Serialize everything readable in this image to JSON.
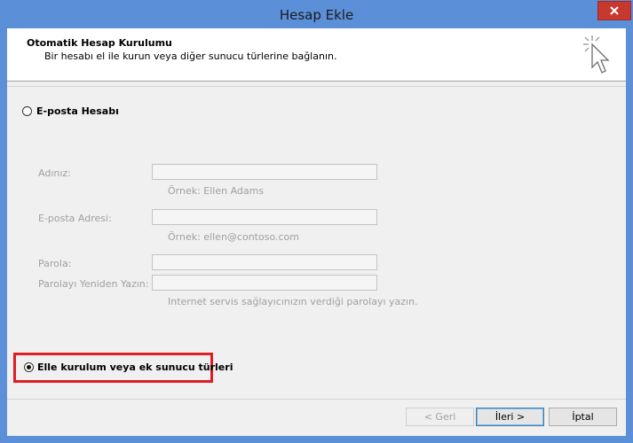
{
  "window": {
    "title": "Hesap Ekle",
    "close_glyph": "✕"
  },
  "header": {
    "title": "Otomatik Hesap Kurulumu",
    "subtitle": "Bir hesabı el ile kurun veya diğer sunucu türlerine bağlanın.",
    "icon": "wizard-cursor-sparkle-icon"
  },
  "options": {
    "email_account_label": "E-posta Hesabı",
    "manual_setup_label": "Elle kurulum veya ek sunucu türleri",
    "selected": "manual_setup"
  },
  "form": {
    "name_label": "Adınız:",
    "name_hint": "Örnek: Ellen Adams",
    "email_label": "E-posta Adresi:",
    "email_hint": "Örnek: ellen@contoso.com",
    "password_label": "Parola:",
    "password_retype_label": "Parolayı Yeniden Yazın:",
    "password_hint": "Internet servis sağlayıcınızın verdiği parolayı yazın."
  },
  "buttons": {
    "back": "< Geri",
    "next": "İleri >",
    "cancel": "İptal"
  },
  "colors": {
    "titlebar": "#5b8fd8",
    "close_button": "#c7382f",
    "highlight": "#e01d24",
    "dialog_bg": "#f0f0f0"
  }
}
